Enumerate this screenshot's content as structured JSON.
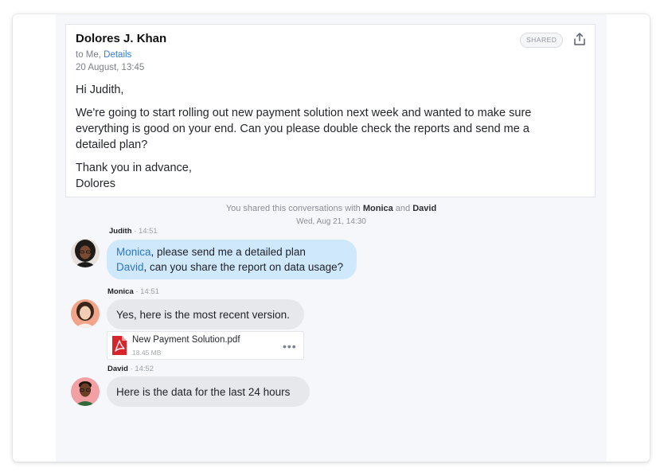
{
  "email": {
    "sender": "Dolores J. Khan",
    "to_prefix": "to Me, ",
    "details_link": "Details",
    "date": "20 August, 13:45",
    "badge": "SHARED",
    "greeting": "Hi Judith,",
    "paragraph": "We're going to start rolling out new payment solution next week and wanted to make sure everything is good on your end. Can you please double check the reports and send me a detailed plan?",
    "closing": "Thank you in advance,\nDolores"
  },
  "share_note": {
    "prefix": "You shared this conversations with ",
    "name1": "Monica",
    "conj": " and ",
    "name2": "David",
    "date": "Wed, Aug 21, 14:30"
  },
  "messages": [
    {
      "author": "Judith",
      "time": " · 14:51",
      "lines": [
        {
          "mention": "Monica",
          "text": ", please send me a detailed plan"
        },
        {
          "mention": "David",
          "text": ", can you share the report on data usage?"
        }
      ]
    },
    {
      "author": "Monica",
      "time": " · 14:51",
      "text": "Yes, here is the most recent version.",
      "attachment": {
        "name": "New Payment Solution.pdf",
        "size": "18.45 MB"
      }
    },
    {
      "author": "David",
      "time": " · 14:52",
      "text": "Here is the data for the last 24 hours"
    }
  ],
  "icons": {
    "share": "share-upload-icon",
    "pdf": "pdf-file-icon",
    "more": "more-horizontal-icon"
  },
  "colors": {
    "accent": "#2f7bd9",
    "bubble_blue": "#cfe8fc",
    "bubble_gray": "#e7e8ec",
    "pdf_red": "#d6252b"
  }
}
